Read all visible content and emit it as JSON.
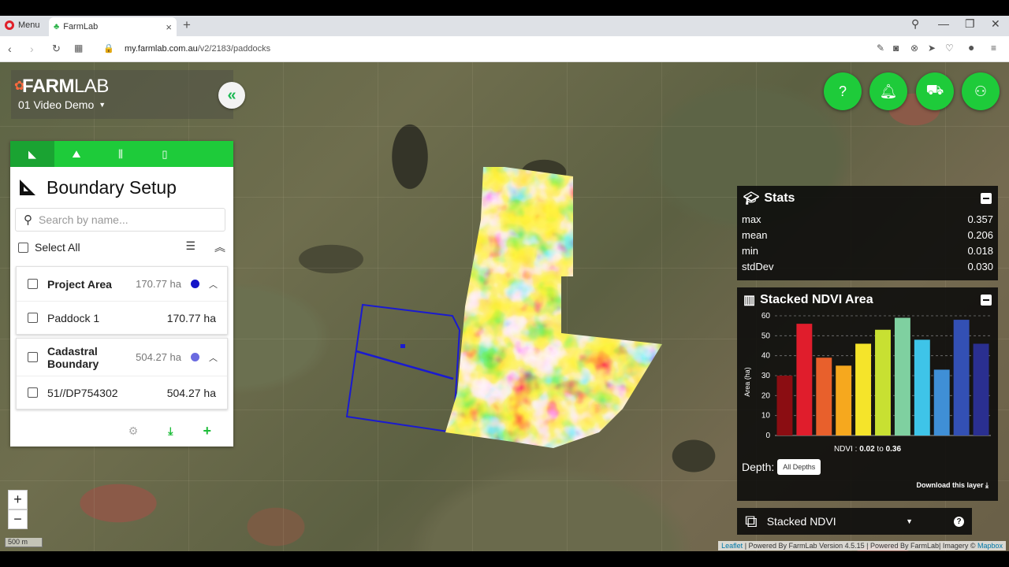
{
  "browser": {
    "menu_label": "Menu",
    "tab_title": "FarmLab",
    "url_domain": "my.farmlab.com.au",
    "url_path": "/v2/2183/paddocks"
  },
  "app": {
    "logo_main": "FARM",
    "logo_sub": "LAB",
    "project_name": "01 Video Demo"
  },
  "panel": {
    "title": "Boundary Setup",
    "search_placeholder": "Search by name...",
    "select_all": "Select All",
    "groups": [
      {
        "name": "Project Area",
        "area": "170.77 ha",
        "color": "#1515c8",
        "children": [
          {
            "name": "Paddock 1",
            "area": "170.77 ha"
          }
        ]
      },
      {
        "name": "Cadastral Boundary",
        "area": "504.27 ha",
        "color": "#6a6ae0",
        "children": [
          {
            "name": "51//DP754302",
            "area": "504.27 ha"
          }
        ]
      }
    ]
  },
  "stats": {
    "title": "Stats",
    "rows": [
      {
        "label": "max",
        "value": "0.357"
      },
      {
        "label": "mean",
        "value": "0.206"
      },
      {
        "label": "min",
        "value": "0.018"
      },
      {
        "label": "stdDev",
        "value": "0.030"
      }
    ]
  },
  "ndvi": {
    "title": "Stacked NDVI Area",
    "range_prefix": "NDVI : ",
    "range_from": "0.02",
    "range_to_word": " to ",
    "range_to": "0.36",
    "depth_label": "Depth:",
    "depth_button": "All Depths",
    "download_label": "Download this layer"
  },
  "chart_data": {
    "type": "bar",
    "ylabel": "Area (ha)",
    "ylim": [
      0,
      60
    ],
    "yticks": [
      0,
      10,
      20,
      30,
      40,
      50,
      60
    ],
    "values": [
      30,
      56,
      39,
      35,
      46,
      53,
      59,
      48,
      33,
      58,
      46
    ],
    "colors": [
      "#8b0d12",
      "#e01d2c",
      "#e8602c",
      "#f6a81e",
      "#f5e42a",
      "#c8e032",
      "#7fd0a0",
      "#3ec4e8",
      "#3f8fd6",
      "#3350b4",
      "#2a2f90"
    ]
  },
  "layer": {
    "name": "Stacked NDVI"
  },
  "map": {
    "scale_label": "500 m",
    "attribution_leaflet": "Leaflet",
    "attribution_text": " | Powered By FarmLab Version 4.5.15 | Powered By FarmLab| Imagery © ",
    "attribution_mapbox": "Mapbox",
    "zoom_in": "+",
    "zoom_out": "−"
  }
}
